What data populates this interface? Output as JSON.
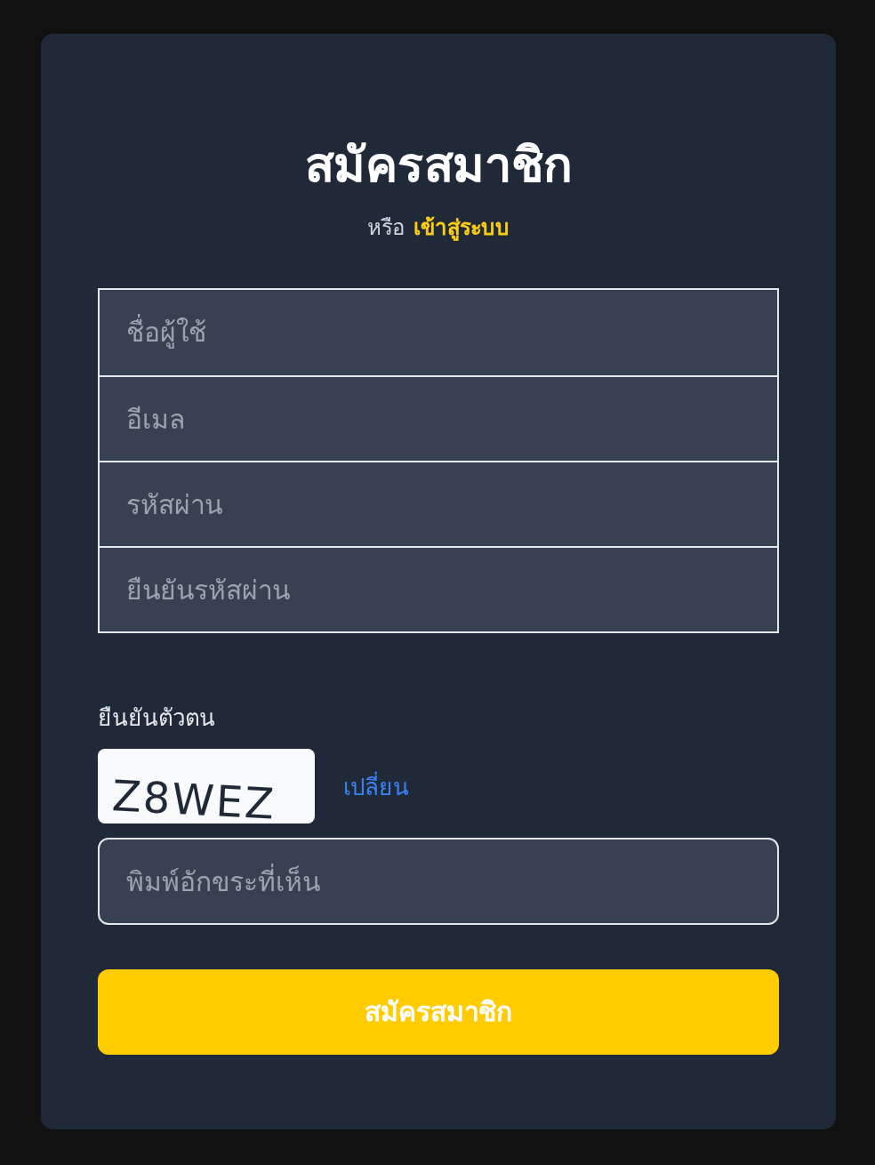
{
  "title": "สมัครสมาชิก",
  "subtitle": {
    "text": "หรือ",
    "link": "เข้าสู่ระบบ"
  },
  "fields": [
    {
      "placeholder": "ชื่อผู้ใช้"
    },
    {
      "placeholder": "อีเมล"
    },
    {
      "placeholder": "รหัสผ่าน"
    },
    {
      "placeholder": "ยืนยันรหัสผ่าน"
    }
  ],
  "captcha": {
    "label": "ยืนยันตัวตน",
    "code": "Z8WEZ",
    "refresh": "เปลี่ยน",
    "placeholder": "พิมพ์อักขระที่เห็น"
  },
  "submit": "สมัครสมาชิก"
}
